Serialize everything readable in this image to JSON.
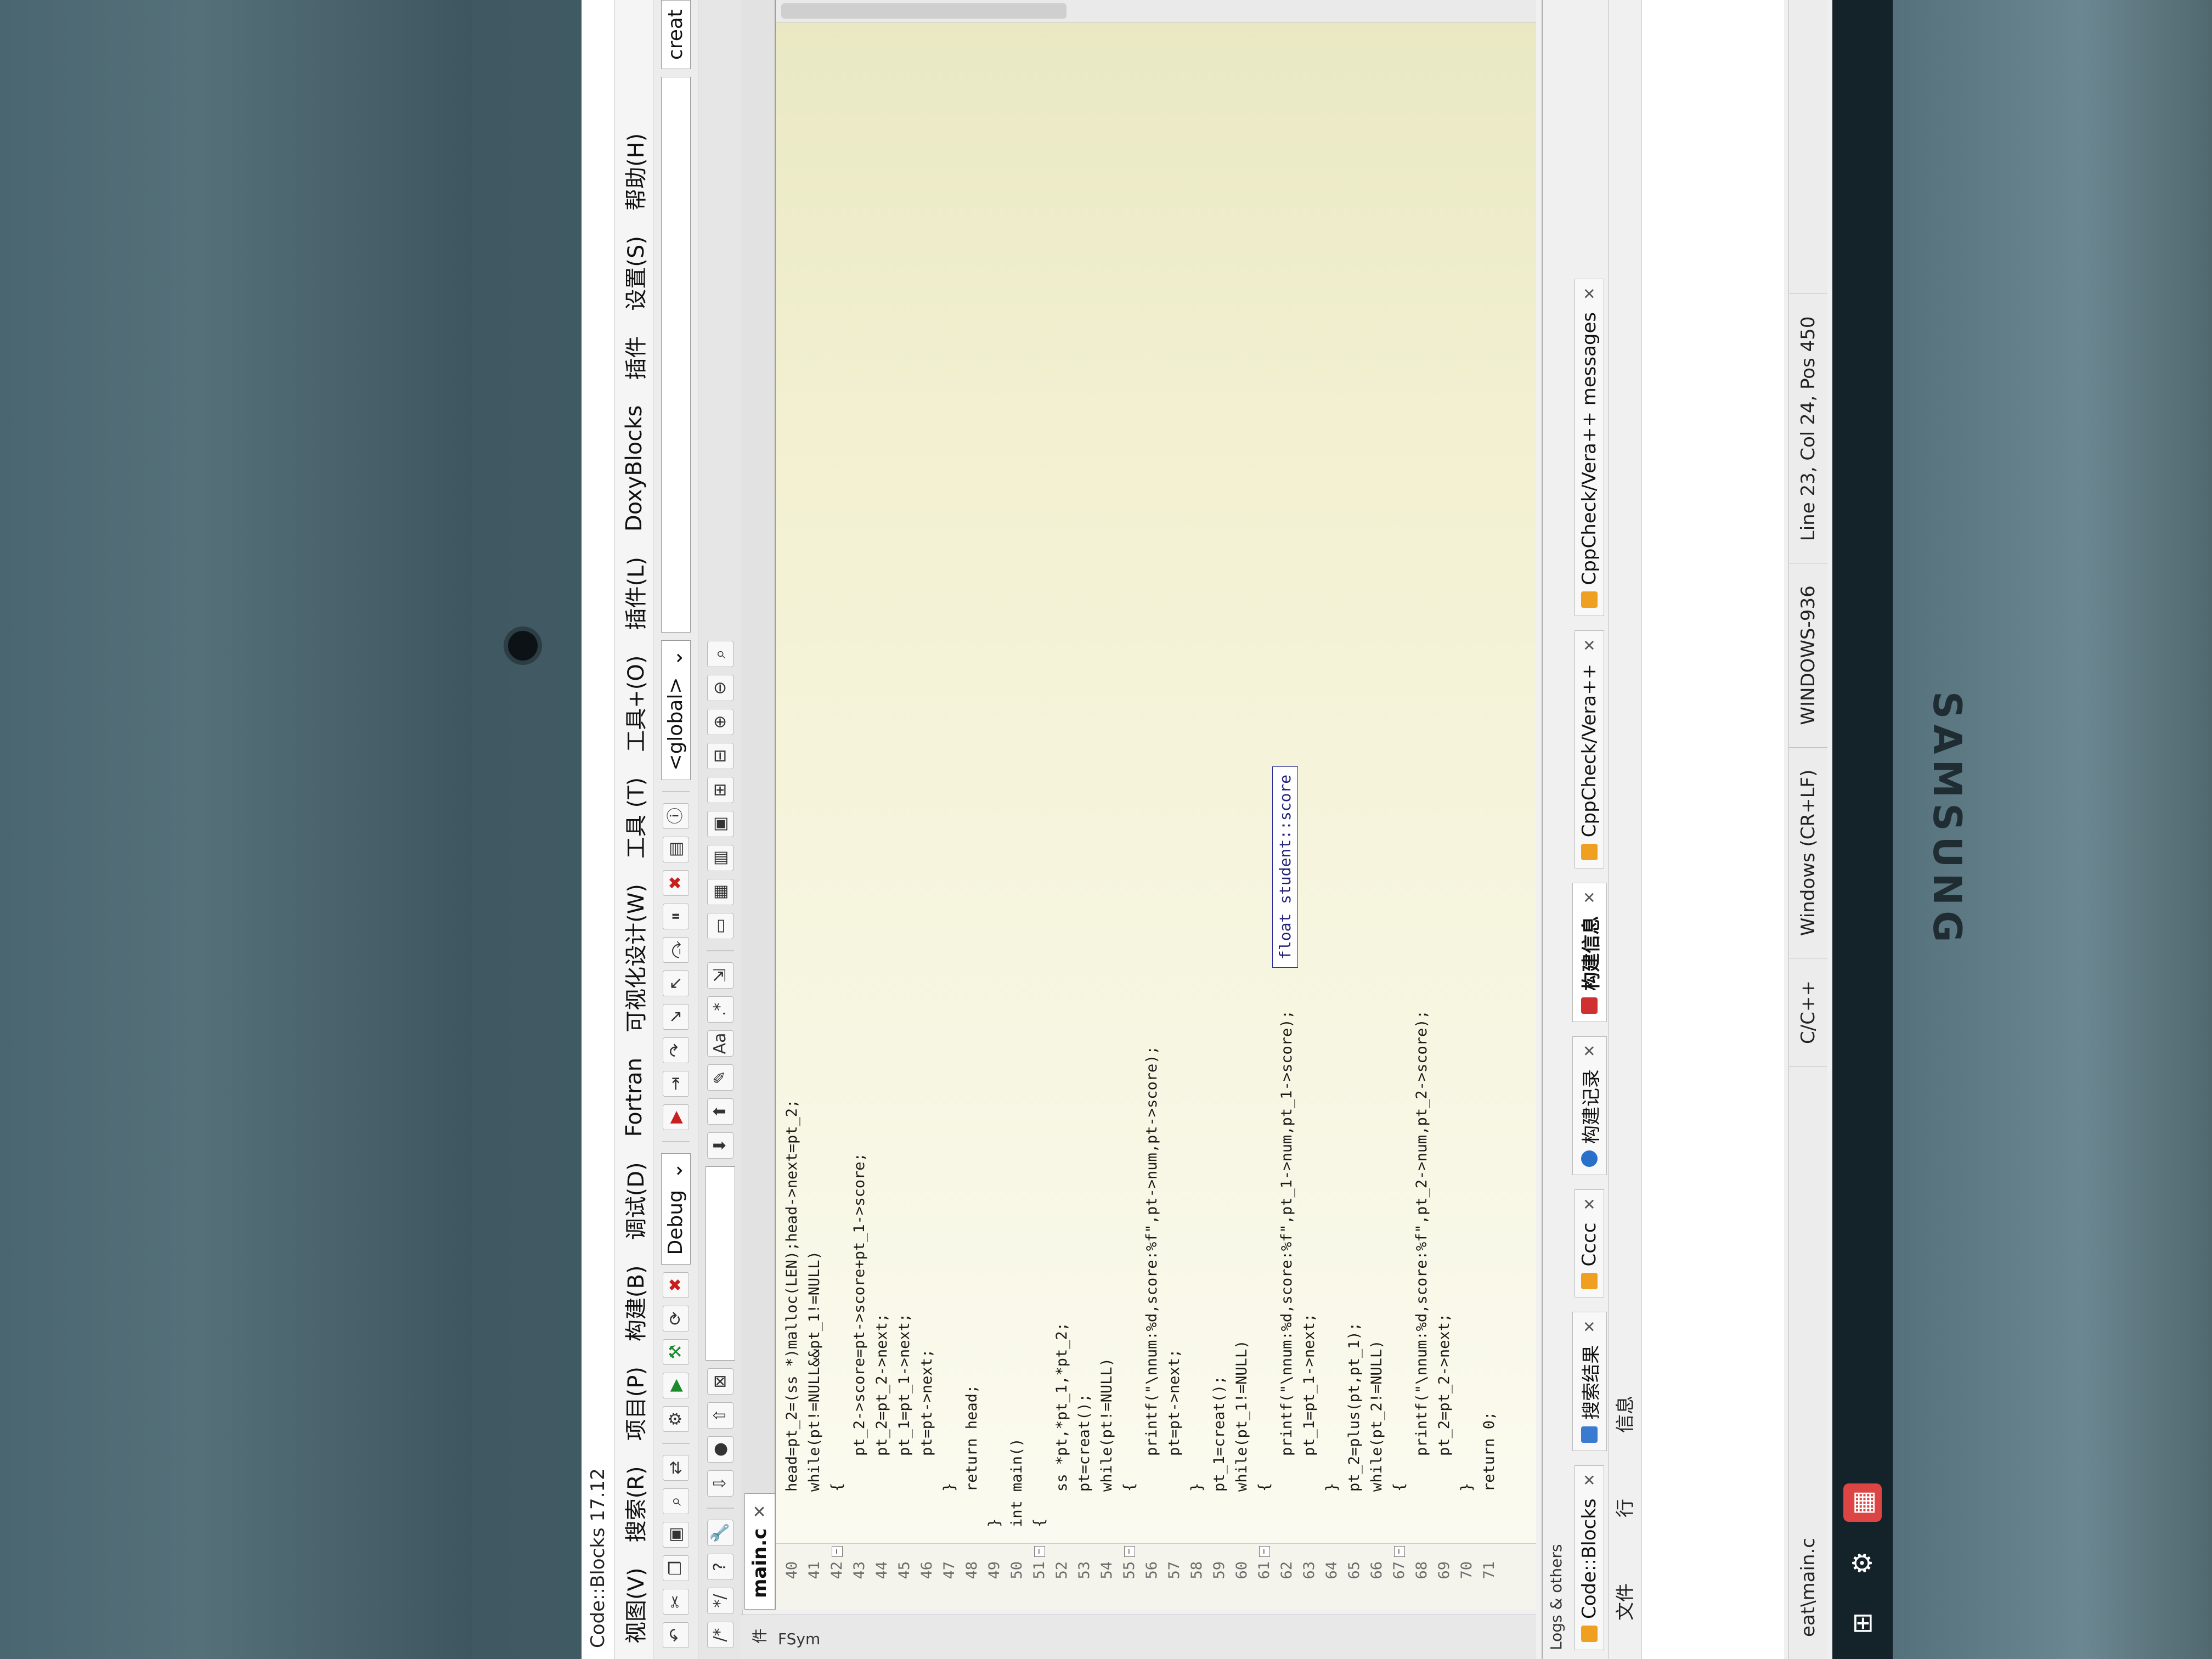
{
  "window": {
    "title": "Code::Blocks 17.12"
  },
  "menu": [
    "视图(V)",
    "搜索(R)",
    "项目(P)",
    "构建(B)",
    "调试(D)",
    "Fortran",
    "可视化设计(W)",
    "工具 (T)",
    "工具+(O)",
    "插件(L)",
    "DoxyBlocks",
    "插件",
    "设置(S)",
    "帮助(H)"
  ],
  "toolbar": {
    "build_target": "Debug",
    "scope": "<global>",
    "right_combo": "creat"
  },
  "left_panel": {
    "tab1": "件",
    "tab2": "FSym"
  },
  "editor": {
    "file_tab": "main.c",
    "lines": [
      {
        "n": "40",
        "t": "    head=pt_2=(ss *)malloc(LEN);head->next=pt_2;"
      },
      {
        "n": "41",
        "t": "    while(pt!=NULL&&pt_1!=NULL)"
      },
      {
        "n": "42",
        "t": "    {"
      },
      {
        "n": "43",
        "t": "        pt_2->score=pt->score+pt_1->score;"
      },
      {
        "n": "44",
        "t": "        pt_2=pt_2->next;"
      },
      {
        "n": "45",
        "t": "        pt_1=pt_1->next;"
      },
      {
        "n": "46",
        "t": "        pt=pt->next;"
      },
      {
        "n": "47",
        "t": "    }"
      },
      {
        "n": "48",
        "t": "    return head;"
      },
      {
        "n": "49",
        "t": "}"
      },
      {
        "n": "50",
        "t": "int main()"
      },
      {
        "n": "51",
        "t": "{"
      },
      {
        "n": "52",
        "t": "    ss *pt,*pt_1,*pt_2;"
      },
      {
        "n": "53",
        "t": "    pt=creat();"
      },
      {
        "n": "54",
        "t": "    while(pt!=NULL)"
      },
      {
        "n": "55",
        "t": "    {"
      },
      {
        "n": "56",
        "t": "        printf(\"\\nnum:%d,score:%f\",pt->num,pt->score);"
      },
      {
        "n": "57",
        "t": "        pt=pt->next;"
      },
      {
        "n": "58",
        "t": "    }"
      },
      {
        "n": "59",
        "t": "    pt_1=creat();"
      },
      {
        "n": "60",
        "t": "    while(pt_1!=NULL)"
      },
      {
        "n": "61",
        "t": "    {"
      },
      {
        "n": "62",
        "t": "        printf(\"\\nnum:%d,score:%f\",pt_1->num,pt_1->score);"
      },
      {
        "n": "63",
        "t": "        pt_1=pt_1->next;"
      },
      {
        "n": "64",
        "t": "    }"
      },
      {
        "n": "65",
        "t": "    pt_2=plus(pt,pt_1);"
      },
      {
        "n": "66",
        "t": "    while(pt_2!=NULL)"
      },
      {
        "n": "67",
        "t": "    {"
      },
      {
        "n": "68",
        "t": "        printf(\"\\nnum:%d,score:%f\",pt_2->num,pt_2->score);"
      },
      {
        "n": "69",
        "t": "        pt_2=pt_2->next;"
      },
      {
        "n": "70",
        "t": "    }"
      },
      {
        "n": "71",
        "t": "    return 0;"
      }
    ],
    "tooltip": "float student::score"
  },
  "logs": {
    "title": "Logs & others",
    "tabs": [
      "Code::Blocks",
      "搜索结果",
      "Cccc",
      "构建记录",
      "构建信息",
      "CppCheck/Vera++",
      "CppCheck/Vera++ messages"
    ],
    "active_tab": "构建信息",
    "columns": [
      "文件",
      "行",
      "信息"
    ]
  },
  "status": {
    "file": "eat\\main.c",
    "language": "C/C++",
    "eol": "Windows (CR+LF)",
    "encoding": "WINDOWS-936",
    "position": "Line 23, Col 24, Pos 450"
  },
  "brand": "SAMSUNG"
}
